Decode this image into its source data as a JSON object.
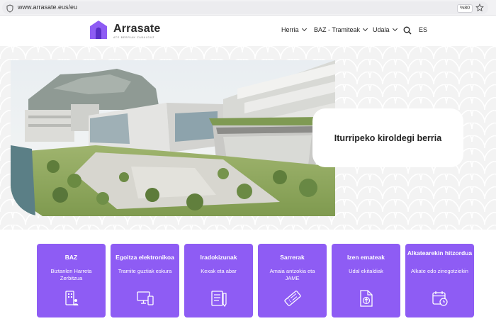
{
  "browser": {
    "url": "www.arrasate.eus/eu",
    "zoom": "%80"
  },
  "header": {
    "logo_name": "Arrasate",
    "logo_tagline": "ATE BERRIAK ZABALDUZ",
    "nav": [
      {
        "label": "Herria",
        "has_dropdown": true
      },
      {
        "label": "BAZ - Tramiteak",
        "has_dropdown": true
      },
      {
        "label": "Udala",
        "has_dropdown": true
      }
    ],
    "language": "ES",
    "brand_color": "#8e5cf4"
  },
  "hero": {
    "title": "Iturripeko kiroldegi berria",
    "image_icon": "sports-center-rendering"
  },
  "tiles": [
    {
      "title": "BAZ",
      "subtitle": "Biztanlen Harreta Zerbitzua",
      "icon": "people-building-icon"
    },
    {
      "title": "Egoitza elektronikoa",
      "subtitle": "Tramite guztiak eskura",
      "icon": "devices-icon"
    },
    {
      "title": "Iradokizunak",
      "subtitle": "Kexak eta abar",
      "icon": "document-pencil-icon"
    },
    {
      "title": "Sarrerak",
      "subtitle": "Amaia antzokia eta JAME",
      "icon": "ticket-icon"
    },
    {
      "title": "Izen emateak",
      "subtitle": "Udal ekitaldiak",
      "icon": "upload-document-icon"
    },
    {
      "title": "Alkatearekin hitzordua",
      "subtitle": "Alkate edo zinegotziekin",
      "icon": "calendar-clock-icon"
    }
  ]
}
